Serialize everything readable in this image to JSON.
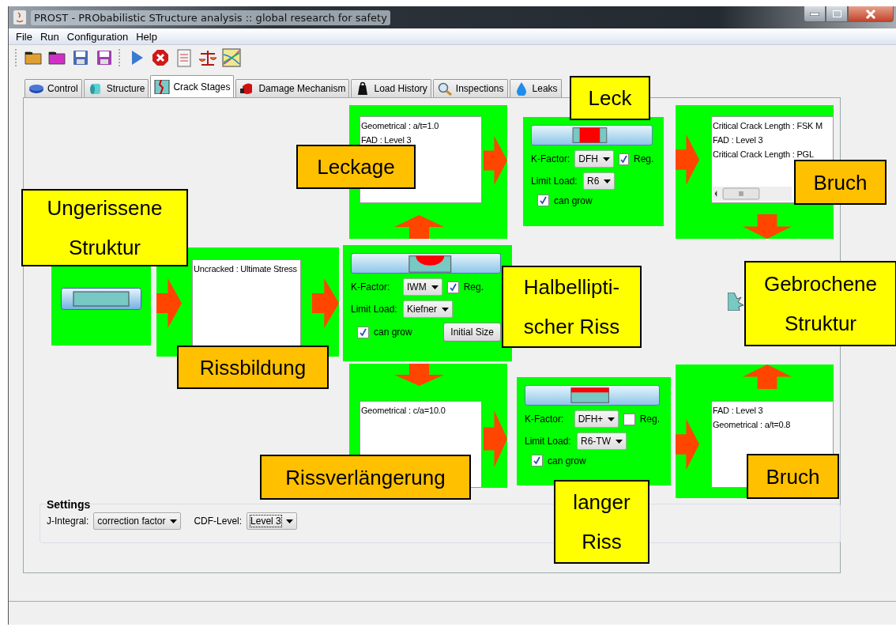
{
  "window": {
    "title": "PROST - PRObabilistic STructure analysis :: global research for safety"
  },
  "menu": [
    "File",
    "Run",
    "Configuration",
    "Help"
  ],
  "tabs": [
    {
      "label": "Control",
      "selected": false
    },
    {
      "label": "Structure",
      "selected": false
    },
    {
      "label": "Crack Stages",
      "selected": true
    },
    {
      "label": "Damage Mechanism",
      "selected": false
    },
    {
      "label": "Load History",
      "selected": false
    },
    {
      "label": "Inspections",
      "selected": false
    },
    {
      "label": "Leaks",
      "selected": false
    }
  ],
  "lists": [
    {
      "items": [
        "Uncracked : Ultimate Stress"
      ]
    },
    {
      "items": [
        "Geometrical : a/t=1.0",
        "FAD : Level 3"
      ]
    },
    {
      "items": [
        "Critical Crack Length : FSK M",
        "FAD : Level 3",
        "Critical Crack Length : PGL"
      ],
      "scrollbar": true
    },
    {
      "items": [
        "Geometrical : c/a=10.0"
      ]
    },
    {
      "items": [
        "FAD : Level 3",
        "Geometrical : a/t=0.8"
      ]
    }
  ],
  "crack_panels": [
    {
      "kind": "semi-elliptical",
      "k_factor": {
        "label": "K-Factor:",
        "value": "IWM"
      },
      "reg": {
        "label": "Reg.",
        "checked": true
      },
      "limit_load": {
        "label": "Limit Load:",
        "value": "Kiefner"
      },
      "can_grow": {
        "label": "can grow",
        "checked": true
      },
      "button": "Initial Size"
    },
    {
      "kind": "through-wall",
      "k_factor": {
        "label": "K-Factor:",
        "value": "DFH"
      },
      "reg": {
        "label": "Reg.",
        "checked": true
      },
      "limit_load": {
        "label": "Limit Load:",
        "value": "R6"
      },
      "can_grow": {
        "label": "can grow",
        "checked": true
      }
    },
    {
      "kind": "long",
      "k_factor": {
        "label": "K-Factor:",
        "value": "DFH+"
      },
      "reg": {
        "label": "Reg.",
        "checked": false
      },
      "limit_load": {
        "label": "Limit Load:",
        "value": "R6-TW"
      },
      "can_grow": {
        "label": "can grow",
        "checked": true
      }
    }
  ],
  "annotations": [
    {
      "lines": [
        "Ungerissene",
        "Struktur"
      ],
      "color": "#ffff00"
    },
    {
      "lines": [
        "Leckage"
      ],
      "color": "#ffc000"
    },
    {
      "lines": [
        "Leck"
      ],
      "color": "#ffff00"
    },
    {
      "lines": [
        "Bruch"
      ],
      "color": "#ffc000"
    },
    {
      "lines": [
        "Halbellipti-",
        "scher Riss"
      ],
      "color": "#ffff00"
    },
    {
      "lines": [
        "Gebrochene",
        "Struktur"
      ],
      "color": "#ffff00"
    },
    {
      "lines": [
        "Rissbildung"
      ],
      "color": "#ffc000"
    },
    {
      "lines": [
        "Rissverlängerung"
      ],
      "color": "#ffc000"
    },
    {
      "lines": [
        "langer",
        "Riss"
      ],
      "color": "#ffff00"
    },
    {
      "lines": [
        "Bruch"
      ],
      "color": "#ffc000"
    }
  ],
  "settings": {
    "title": "Settings",
    "j_integral": {
      "label": "J-Integral:",
      "value": "correction factor"
    },
    "cdf_level": {
      "label": "CDF-Level:",
      "value": "Level 3"
    }
  }
}
